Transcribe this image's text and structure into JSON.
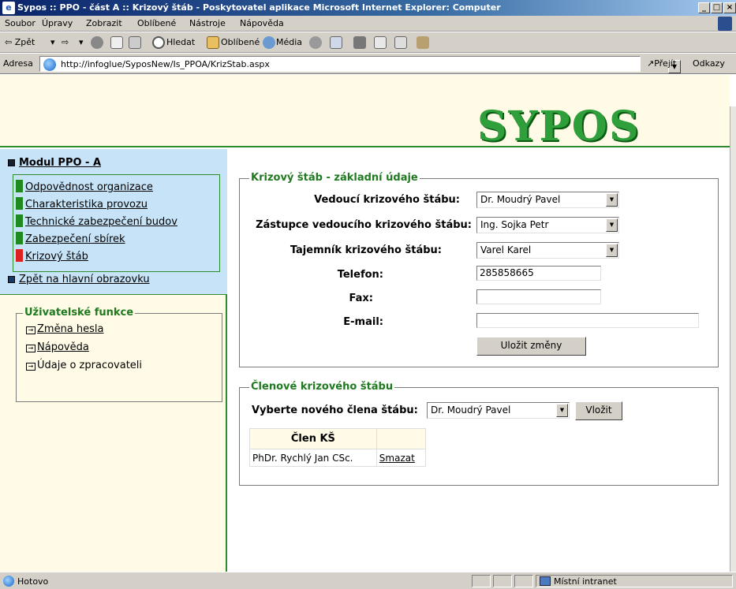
{
  "window": {
    "title": "Sypos :: PPO - část A :: Krizový štáb - Poskytovatel aplikace Microsoft Internet Explorer: Computer",
    "minimize": "_",
    "maximize": "□",
    "close": "×"
  },
  "menu": [
    "Soubor",
    "Úpravy",
    "Zobrazit",
    "Oblíbené",
    "Nástroje",
    "Nápověda"
  ],
  "toolbar": {
    "back": "⇦ Zpět",
    "search": "Hledat",
    "favorites": "Oblíbené",
    "media": "Média"
  },
  "address": {
    "label": "Adresa",
    "url": "http://infoglue/SyposNew/Is_PPOA/KrizStab.aspx",
    "go": "Přejít",
    "links": "Odkazy"
  },
  "logo": "SYPOS",
  "sidebar": {
    "module_title": "Modul PPO - A",
    "items": [
      {
        "label": "Odpovědnost organizace",
        "color": "#1f8a1f"
      },
      {
        "label": "Charakteristika provozu",
        "color": "#1f8a1f"
      },
      {
        "label": "Technické zabezpečení budov",
        "color": "#1f8a1f"
      },
      {
        "label": "Zabezpečení sbírek",
        "color": "#1f8a1f"
      },
      {
        "label": "Krizový štáb",
        "color": "#e02020"
      }
    ],
    "back_link": "Zpět na hlavní obrazovku",
    "user_functions": {
      "legend": "Uživatelské funkce",
      "items": [
        "Změna hesla",
        "Nápověda",
        "Údaje o zpracovateli"
      ]
    }
  },
  "form": {
    "legend": "Krizový štáb - základní údaje",
    "leader_label": "Vedoucí krizového štábu:",
    "leader_value": "Dr. Moudrý Pavel",
    "deputy_label": "Zástupce vedoucího krizového štábu:",
    "deputy_value": "Ing. Sojka Petr",
    "secretary_label": "Tajemník krizového štábu:",
    "secretary_value": "Varel Karel",
    "phone_label": "Telefon:",
    "phone_value": "285858665",
    "fax_label": "Fax:",
    "fax_value": "",
    "email_label": "E-mail:",
    "email_value": "",
    "save_button": "Uložit změny"
  },
  "members": {
    "legend": "Členové krizového štábu",
    "select_label": "Vyberte nového člena štábu:",
    "select_value": "Dr. Moudrý Pavel",
    "insert_button": "Vložit",
    "table_header": "Člen KŠ",
    "rows": [
      {
        "name": "PhDr. Rychlý Jan CSc.",
        "action": "Smazat"
      }
    ]
  },
  "status": {
    "text": "Hotovo",
    "zone": "Místní intranet"
  }
}
